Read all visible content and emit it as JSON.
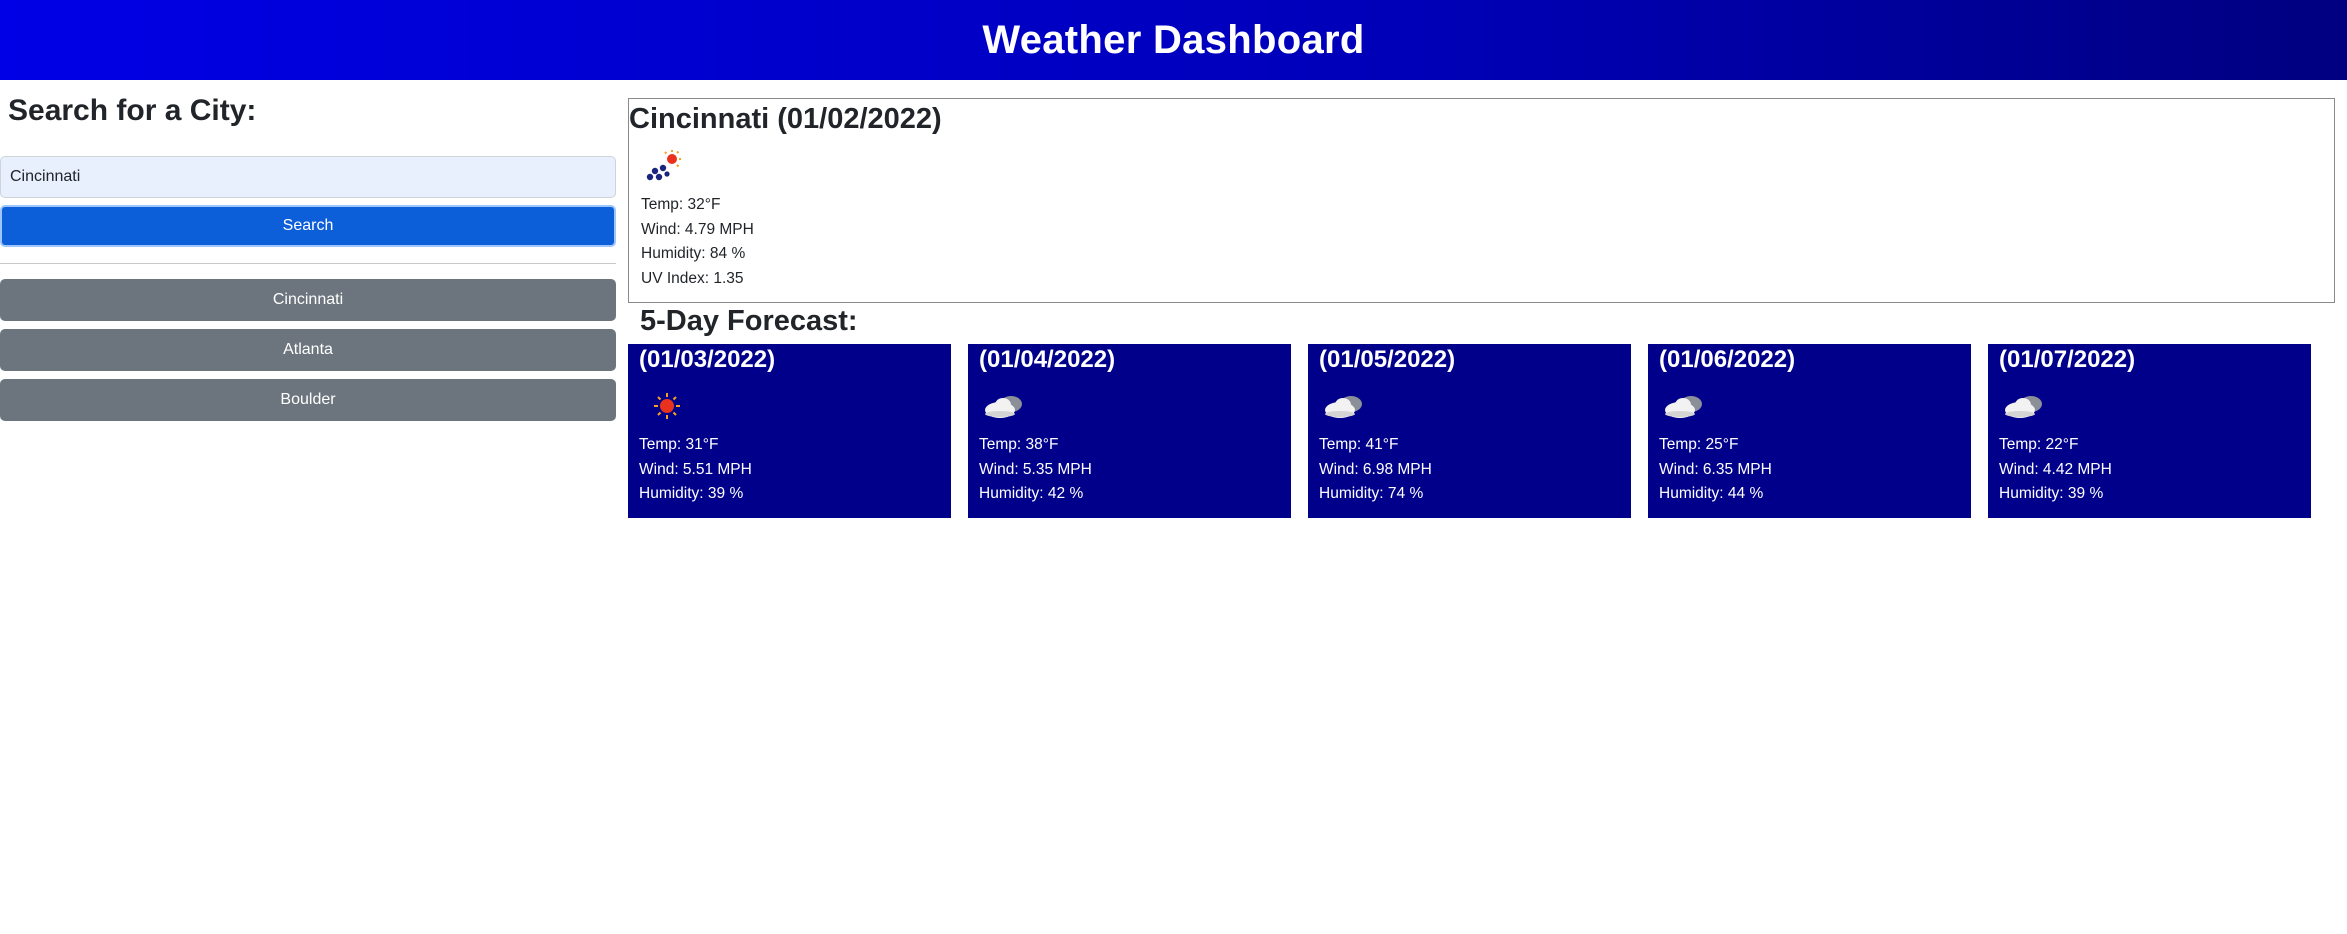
{
  "header": {
    "title": "Weather Dashboard"
  },
  "sidebar": {
    "title": "Search for a City:",
    "search_value": "Cincinnati",
    "search_button_label": "Search",
    "history": [
      {
        "label": "Cincinnati"
      },
      {
        "label": "Atlanta"
      },
      {
        "label": "Boulder"
      }
    ]
  },
  "current": {
    "title": "Cincinnati (01/02/2022)",
    "icon": "snow-sun-icon",
    "temp": "Temp: 32°F",
    "wind": "Wind: 4.79 MPH",
    "humidity": "Humidity: 84 %",
    "uv": "UV Index: 1.35"
  },
  "forecast": {
    "title": "5-Day Forecast:",
    "days": [
      {
        "date": "(01/03/2022)",
        "icon": "sun-icon",
        "temp": "Temp: 31°F",
        "wind": "Wind: 5.51 MPH",
        "humidity": "Humidity: 39 %"
      },
      {
        "date": "(01/04/2022)",
        "icon": "cloud-icon",
        "temp": "Temp: 38°F",
        "wind": "Wind: 5.35 MPH",
        "humidity": "Humidity: 42 %"
      },
      {
        "date": "(01/05/2022)",
        "icon": "cloud-icon",
        "temp": "Temp: 41°F",
        "wind": "Wind: 6.98 MPH",
        "humidity": "Humidity: 74 %"
      },
      {
        "date": "(01/06/2022)",
        "icon": "cloud-icon",
        "temp": "Temp: 25°F",
        "wind": "Wind: 6.35 MPH",
        "humidity": "Humidity: 44 %"
      },
      {
        "date": "(01/07/2022)",
        "icon": "cloud-icon",
        "temp": "Temp: 22°F",
        "wind": "Wind: 4.42 MPH",
        "humidity": "Humidity: 39 %"
      }
    ]
  },
  "colors": {
    "header_gradient_start": "#0000e6",
    "header_gradient_end": "#000080",
    "primary_button": "#0d5fd9",
    "history_button": "#6c757d",
    "forecast_card": "#00008b"
  }
}
